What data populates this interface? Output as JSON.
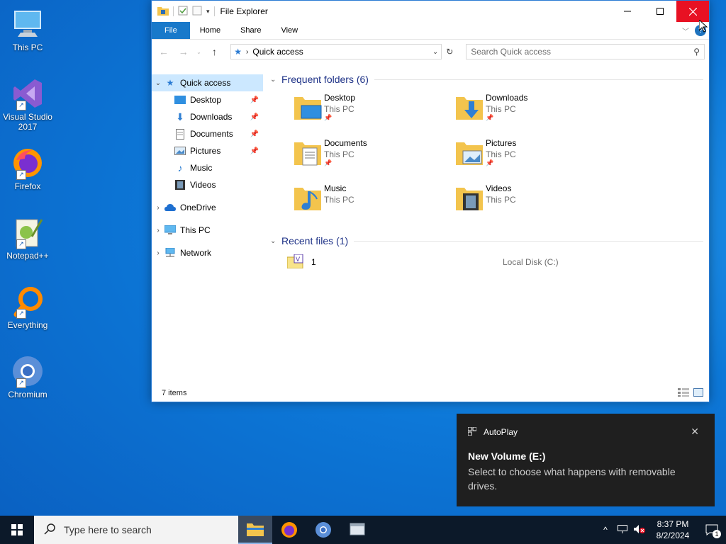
{
  "desktop": {
    "icons": [
      {
        "label": "This PC"
      },
      {
        "label": "Visual Studio 2017"
      },
      {
        "label": "Firefox"
      },
      {
        "label": "Notepad++"
      },
      {
        "label": "Everything"
      },
      {
        "label": "Chromium"
      }
    ]
  },
  "explorer": {
    "title": "File Explorer",
    "ribbon_tabs": [
      "File",
      "Home",
      "Share",
      "View"
    ],
    "address": "Quick access",
    "search_placeholder": "Search Quick access",
    "nav": {
      "quick_access": "Quick access",
      "pinned": [
        {
          "label": "Desktop"
        },
        {
          "label": "Downloads"
        },
        {
          "label": "Documents"
        },
        {
          "label": "Pictures"
        }
      ],
      "unpinned": [
        {
          "label": "Music"
        },
        {
          "label": "Videos"
        }
      ],
      "onedrive": "OneDrive",
      "this_pc": "This PC",
      "network": "Network"
    },
    "frequent_header": "Frequent folders (6)",
    "folders": [
      {
        "name": "Desktop",
        "location": "This PC"
      },
      {
        "name": "Downloads",
        "location": "This PC"
      },
      {
        "name": "Documents",
        "location": "This PC"
      },
      {
        "name": "Pictures",
        "location": "This PC"
      },
      {
        "name": "Music",
        "location": "This PC"
      },
      {
        "name": "Videos",
        "location": "This PC"
      }
    ],
    "recent_header": "Recent files (1)",
    "recent": [
      {
        "name": "1",
        "location": "Local Disk (C:)"
      }
    ],
    "status": "7 items"
  },
  "toast": {
    "app": "AutoPlay",
    "title": "New Volume (E:)",
    "body": "Select to choose what happens with removable drives."
  },
  "taskbar": {
    "search_placeholder": "Type here to search",
    "time": "8:37 PM",
    "date": "8/2/2024",
    "notification_count": "1"
  }
}
